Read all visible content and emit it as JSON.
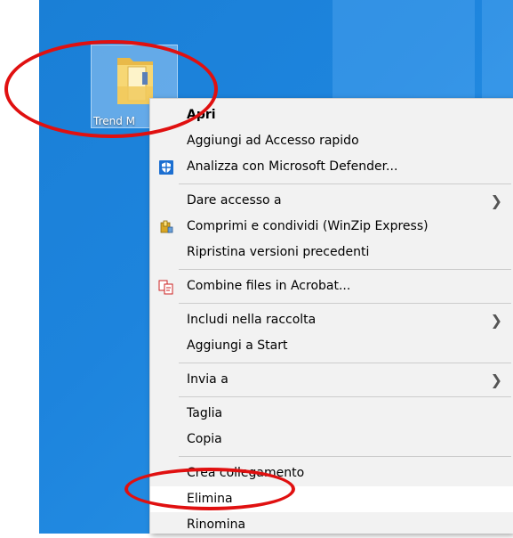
{
  "desktop": {
    "icon_label": "Trend M"
  },
  "menu": {
    "items": [
      {
        "label": "Apri",
        "bold": true
      },
      {
        "label": "Aggiungi ad Accesso rapido"
      },
      {
        "label": "Analizza con Microsoft Defender...",
        "icon": "defender-shield-icon"
      },
      {
        "label": "Dare accesso a",
        "submenu": true
      },
      {
        "label": "Comprimi e condividi (WinZip Express)",
        "icon": "winzip-icon"
      },
      {
        "label": "Ripristina versioni precedenti"
      },
      {
        "label": "Combine files in Acrobat...",
        "icon": "acrobat-combine-icon"
      },
      {
        "label": "Includi nella raccolta",
        "submenu": true
      },
      {
        "label": "Aggiungi a Start"
      },
      {
        "label": "Invia a",
        "submenu": true
      },
      {
        "label": "Taglia"
      },
      {
        "label": "Copia"
      },
      {
        "label": "Crea collegamento"
      },
      {
        "label": "Elimina",
        "highlighted": true
      },
      {
        "label": "Rinomina"
      }
    ],
    "submenu_arrow": ">"
  },
  "colors": {
    "desktop_blue": "#1d84dd",
    "menu_bg": "#f2f2f2",
    "annotation_red": "#e01010"
  }
}
